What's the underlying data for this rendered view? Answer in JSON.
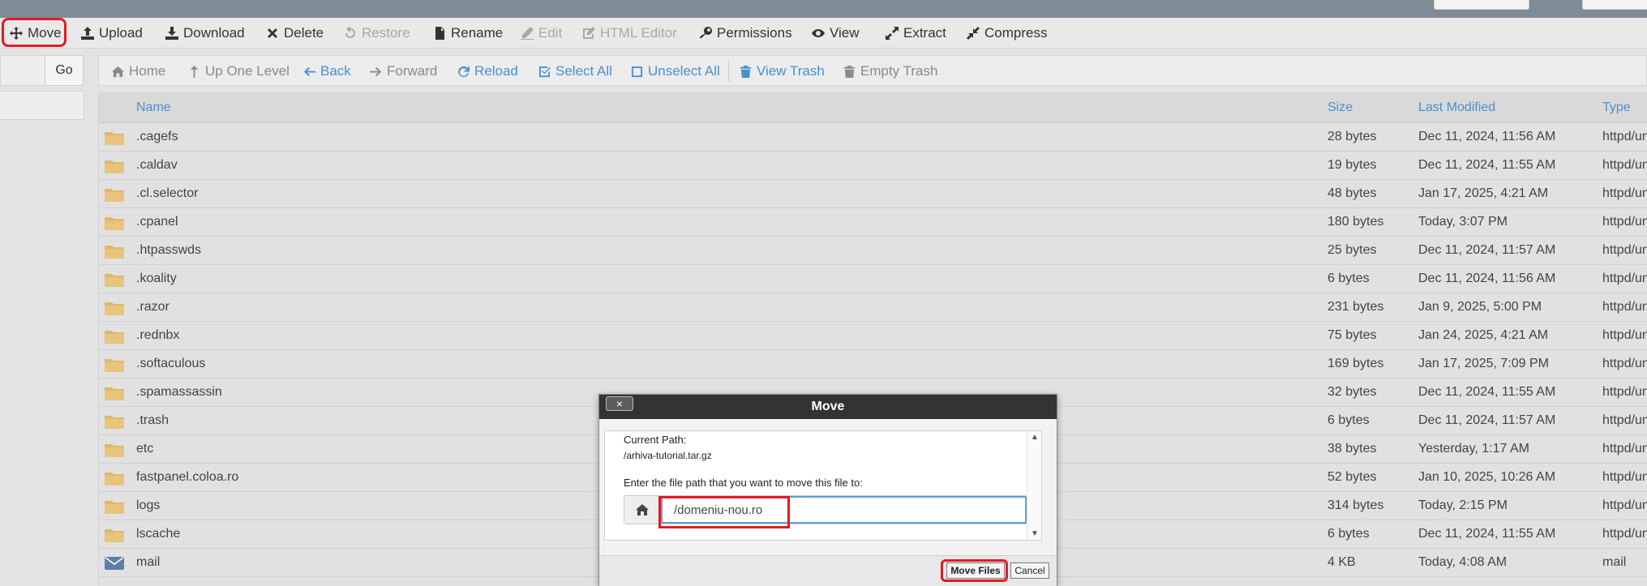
{
  "toolbar": {
    "items": [
      {
        "label": "Move",
        "icon": "move-icon",
        "enabled": true
      },
      {
        "label": "Upload",
        "icon": "upload-icon",
        "enabled": true
      },
      {
        "label": "Download",
        "icon": "download-icon",
        "enabled": true
      },
      {
        "label": "Delete",
        "icon": "delete-icon",
        "enabled": true
      },
      {
        "label": "Restore",
        "icon": "restore-icon",
        "enabled": false
      },
      {
        "label": "Rename",
        "icon": "rename-icon",
        "enabled": true
      },
      {
        "label": "Edit",
        "icon": "edit-icon",
        "enabled": false
      },
      {
        "label": "HTML Editor",
        "icon": "html-editor-icon",
        "enabled": false
      },
      {
        "label": "Permissions",
        "icon": "key-icon",
        "enabled": true
      },
      {
        "label": "View",
        "icon": "eye-icon",
        "enabled": true
      },
      {
        "label": "Extract",
        "icon": "extract-icon",
        "enabled": true
      },
      {
        "label": "Compress",
        "icon": "compress-icon",
        "enabled": true
      }
    ]
  },
  "sidebar": {
    "go_label": "Go"
  },
  "nav": {
    "items": [
      {
        "label": "Home",
        "icon": "home-icon"
      },
      {
        "label": "Up One Level",
        "icon": "up-level-icon"
      },
      {
        "label": "Back",
        "icon": "back-arrow-icon"
      },
      {
        "label": "Forward",
        "icon": "forward-arrow-icon"
      },
      {
        "label": "Reload",
        "icon": "reload-icon"
      },
      {
        "label": "Select All",
        "icon": "checkbox-checked-icon"
      },
      {
        "label": "Unselect All",
        "icon": "checkbox-empty-icon"
      },
      {
        "label": "View Trash",
        "icon": "trash-icon"
      },
      {
        "label": "Empty Trash",
        "icon": "trash-icon"
      }
    ]
  },
  "table": {
    "headers": {
      "name": "Name",
      "size": "Size",
      "modified": "Last Modified",
      "type": "Type"
    },
    "rows": [
      {
        "name": ".cagefs",
        "size": "28 bytes",
        "modified": "Dec 11, 2024, 11:56 AM",
        "type": "httpd/unix-directory",
        "icon": "folder-icon"
      },
      {
        "name": ".caldav",
        "size": "19 bytes",
        "modified": "Dec 11, 2024, 11:55 AM",
        "type": "httpd/unix-directory",
        "icon": "folder-icon"
      },
      {
        "name": ".cl.selector",
        "size": "48 bytes",
        "modified": "Jan 17, 2025, 4:21 AM",
        "type": "httpd/unix-directory",
        "icon": "folder-icon"
      },
      {
        "name": ".cpanel",
        "size": "180 bytes",
        "modified": "Today, 3:07 PM",
        "type": "httpd/unix-directory",
        "icon": "folder-icon"
      },
      {
        "name": ".htpasswds",
        "size": "25 bytes",
        "modified": "Dec 11, 2024, 11:57 AM",
        "type": "httpd/unix-directory",
        "icon": "folder-icon"
      },
      {
        "name": ".koality",
        "size": "6 bytes",
        "modified": "Dec 11, 2024, 11:56 AM",
        "type": "httpd/unix-directory",
        "icon": "folder-icon"
      },
      {
        "name": ".razor",
        "size": "231 bytes",
        "modified": "Jan 9, 2025, 5:00 PM",
        "type": "httpd/unix-directory",
        "icon": "folder-icon"
      },
      {
        "name": ".rednbx",
        "size": "75 bytes",
        "modified": "Jan 24, 2025, 4:21 AM",
        "type": "httpd/unix-directory",
        "icon": "folder-icon"
      },
      {
        "name": ".softaculous",
        "size": "169 bytes",
        "modified": "Jan 17, 2025, 7:09 PM",
        "type": "httpd/unix-directory",
        "icon": "folder-icon"
      },
      {
        "name": ".spamassassin",
        "size": "32 bytes",
        "modified": "Dec 11, 2024, 11:55 AM",
        "type": "httpd/unix-directory",
        "icon": "folder-icon"
      },
      {
        "name": ".trash",
        "size": "6 bytes",
        "modified": "Dec 11, 2024, 11:57 AM",
        "type": "httpd/unix-directory",
        "icon": "folder-icon"
      },
      {
        "name": "etc",
        "size": "38 bytes",
        "modified": "Yesterday, 1:17 AM",
        "type": "httpd/unix-directory",
        "icon": "folder-icon"
      },
      {
        "name": "fastpanel.coloa.ro",
        "size": "52 bytes",
        "modified": "Jan 10, 2025, 10:26 AM",
        "type": "httpd/unix-directory",
        "icon": "folder-icon"
      },
      {
        "name": "logs",
        "size": "314 bytes",
        "modified": "Today, 2:15 PM",
        "type": "httpd/unix-directory",
        "icon": "folder-icon"
      },
      {
        "name": "lscache",
        "size": "6 bytes",
        "modified": "Dec 11, 2024, 11:55 AM",
        "type": "httpd/unix-directory",
        "icon": "folder-icon"
      },
      {
        "name": "mail",
        "size": "4 KB",
        "modified": "Today, 4:08 AM",
        "type": "mail",
        "icon": "mail-icon"
      }
    ]
  },
  "dialog": {
    "title": "Move",
    "close_label": "×",
    "current_path_label": "Current Path:",
    "current_path_value": "/arhiva-tutorial.tar.gz",
    "instruction": "Enter the file path that you want to move this file to:",
    "path_value": "/domeniu-nou.ro",
    "move_button": "Move Files",
    "cancel_button": "Cancel"
  },
  "colors": {
    "accent": "#4a8fd1",
    "highlight": "#e01b24",
    "dialog_header": "#333333",
    "folder": "#e0b86a"
  }
}
